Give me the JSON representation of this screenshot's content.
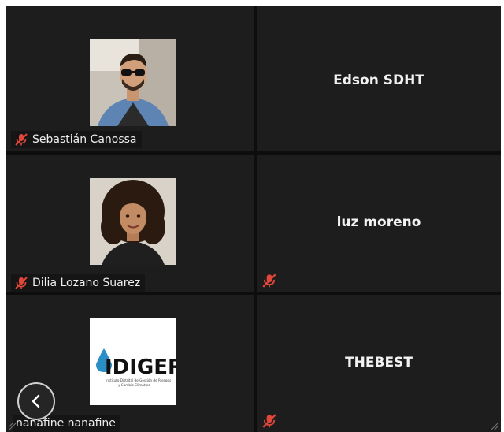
{
  "participants": [
    {
      "name": "Sebastián Canossa",
      "muted": true,
      "has_video": true,
      "avatar": "man-sunglasses-photo"
    },
    {
      "name": "Edson SDHT",
      "muted": false,
      "has_video": false
    },
    {
      "name": "Dilia Lozano Suarez",
      "muted": true,
      "has_video": true,
      "avatar": "woman-curly-hair-photo"
    },
    {
      "name": "luz moreno",
      "muted": true,
      "has_video": false
    },
    {
      "name": "nanafine nanafine",
      "muted": false,
      "has_video": true,
      "avatar": "idiger-logo",
      "logo_text": "IDIGER",
      "logo_subtext_1": "Instituto Distrital de Gestión de Riesgos",
      "logo_subtext_2": "y Cambio Climático"
    },
    {
      "name": "THEBEST",
      "muted": true,
      "has_video": false
    }
  ],
  "controls": {
    "back_icon": "chevron-left-icon"
  },
  "colors": {
    "tile": "#1d1d1d",
    "background": "#0d0d0d",
    "muted_icon": "#e0463a",
    "text": "#f2f2f2"
  }
}
